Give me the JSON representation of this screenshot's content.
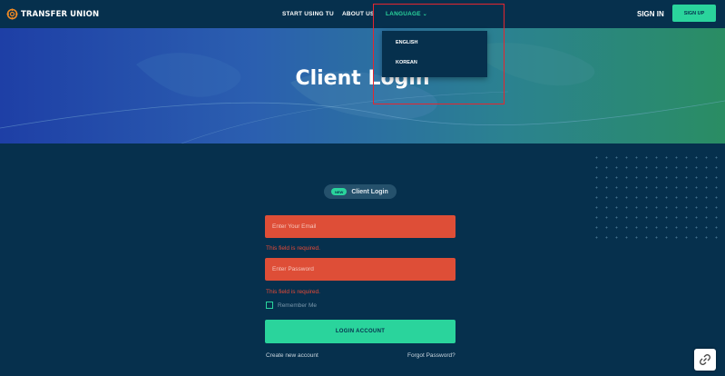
{
  "nav": {
    "brand": "TRANSFER UNION",
    "links": [
      "START USING TU",
      "ABOUT US",
      "LANGUAGE"
    ],
    "signin": "SIGN IN",
    "signup": "SIGN UP"
  },
  "language_dropdown": {
    "options": [
      "ENGLISH",
      "KOREAN"
    ]
  },
  "hero": {
    "title": "Client Login"
  },
  "badge": {
    "tag": "NEW",
    "label": "Client Login"
  },
  "form": {
    "email_placeholder": "Enter Your Email",
    "email_error": "This field is required.",
    "password_placeholder": "Enter Password",
    "password_error": "This field is required.",
    "remember_label": "Remember Me",
    "login_button": "LOGIN ACCOUNT",
    "create_account": "Create new account",
    "forgot_password": "Forgot Password?"
  },
  "colors": {
    "background": "#06304d",
    "accent": "#2ad49c",
    "error": "#de4e37",
    "highlight": "#e5262f"
  },
  "icons": [
    "transfer-union-logo-icon",
    "chevron-down-icon",
    "link-icon"
  ]
}
